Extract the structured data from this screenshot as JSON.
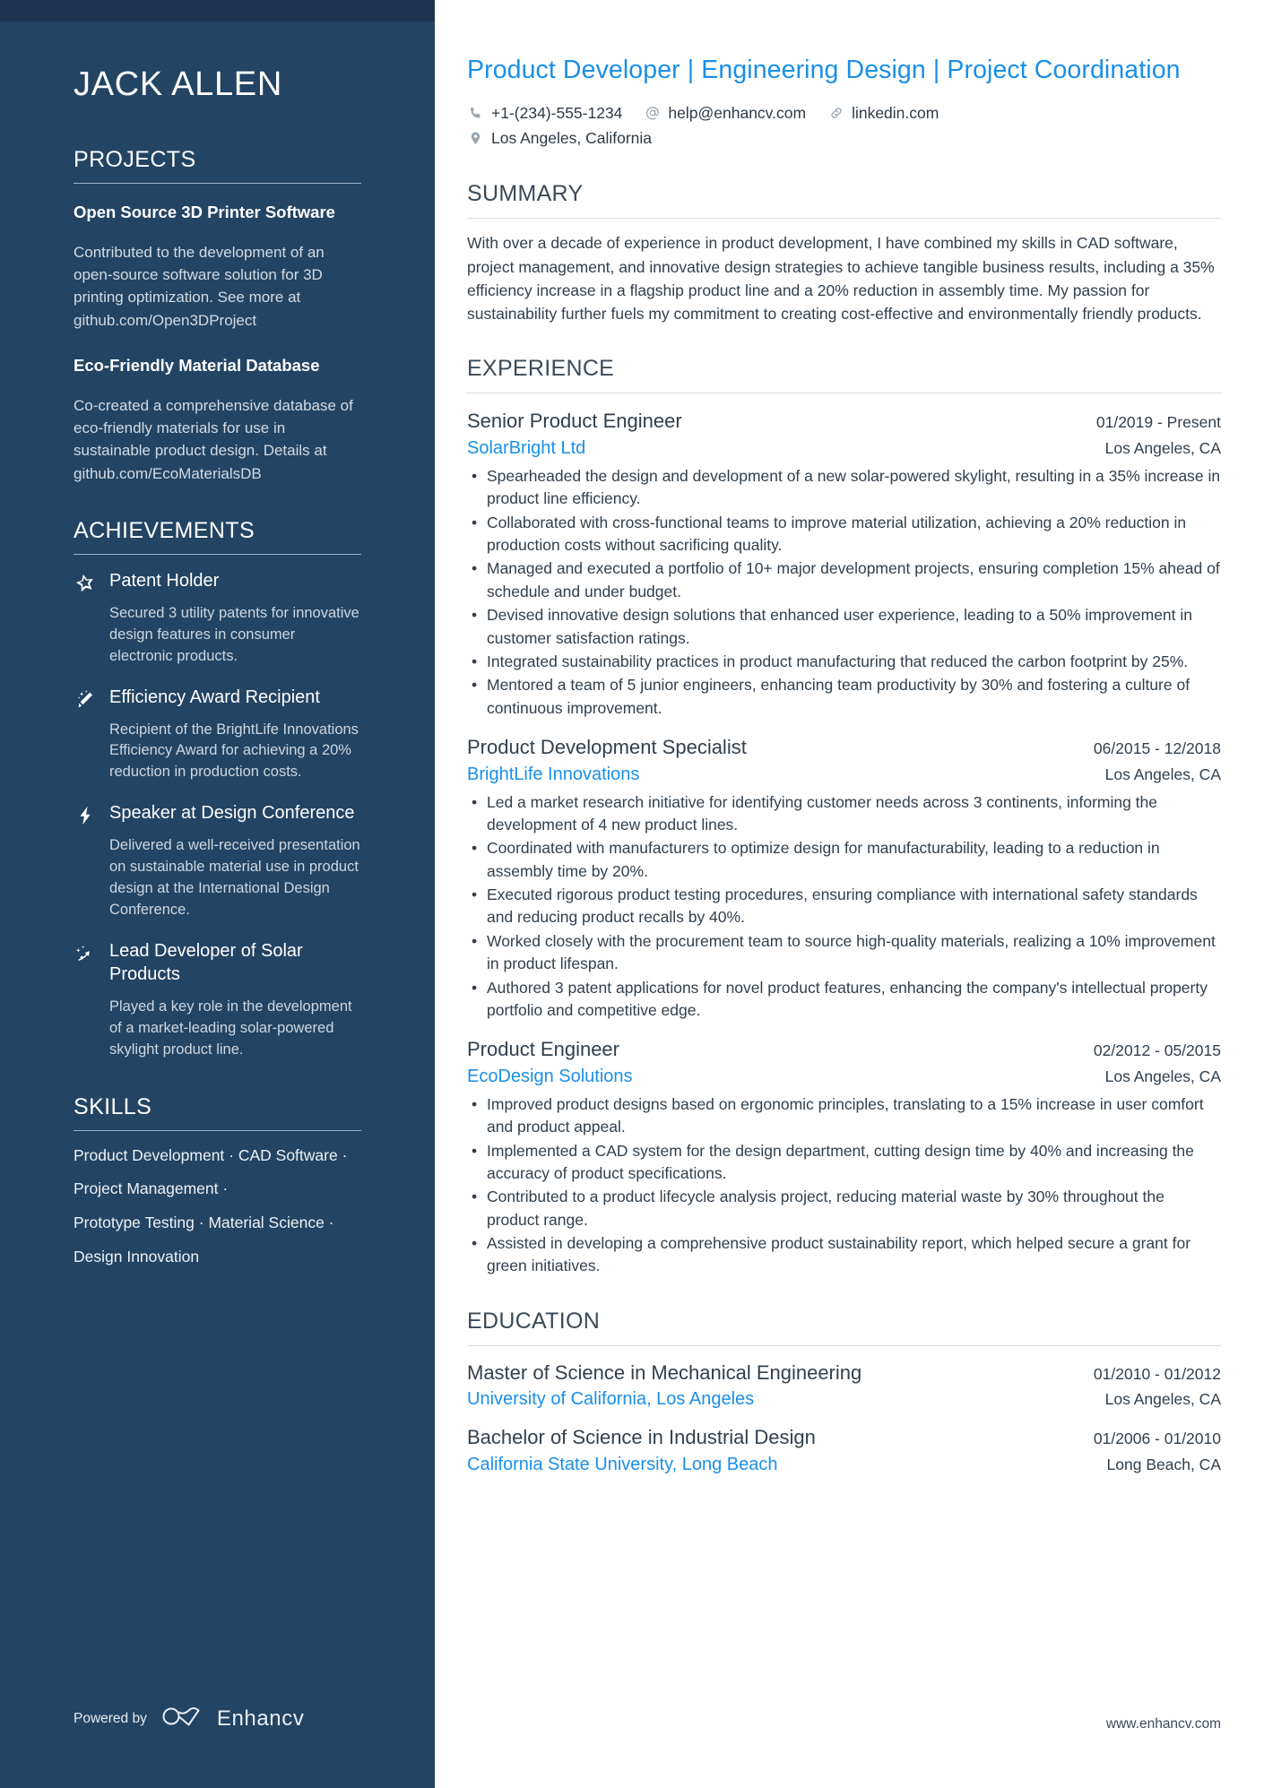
{
  "sidebar": {
    "name": "JACK ALLEN",
    "projects": {
      "title": "PROJECTS",
      "items": [
        {
          "name": "Open Source 3D Printer Software",
          "description": "Contributed to the development of an open-source software solution for 3D printing optimization. See more at github.com/Open3DProject"
        },
        {
          "name": "Eco-Friendly Material Database",
          "description": "Co-created a comprehensive database of eco-friendly materials for use in sustainable product design. Details at github.com/EcoMaterialsDB"
        }
      ]
    },
    "achievements": {
      "title": "ACHIEVEMENTS",
      "items": [
        {
          "icon": "star-icon",
          "name": "Patent Holder",
          "description": "Secured 3 utility patents for innovative design features in consumer electronic products."
        },
        {
          "icon": "magic-wand-icon",
          "name": "Efficiency Award Recipient",
          "description": "Recipient of the BrightLife Innovations Efficiency Award for achieving a 20% reduction in production costs."
        },
        {
          "icon": "lightning-bolt-icon",
          "name": "Speaker at Design Conference",
          "description": "Delivered a well-received presentation on sustainable material use in product design at the International Design Conference."
        },
        {
          "icon": "shooting-star-icon",
          "name": "Lead Developer of Solar Products",
          "description": "Played a key role in the development of a market-leading solar-powered skylight product line."
        }
      ]
    },
    "skills": {
      "title": "SKILLS",
      "lines": [
        "Product Development · CAD Software ·",
        "Project Management ·",
        "Prototype Testing · Material Science ·",
        "Design Innovation"
      ]
    },
    "footer": {
      "powered_by": "Powered by",
      "brand": "Enhancv",
      "logo": "enhancv-infinity-logo"
    }
  },
  "main": {
    "headline": "Product Developer | Engineering Design | Project Coordination",
    "contacts": [
      {
        "icon": "phone-icon",
        "value": "+1-(234)-555-1234"
      },
      {
        "icon": "at-sign-icon",
        "value": "help@enhancv.com"
      },
      {
        "icon": "link-icon",
        "value": "linkedin.com"
      },
      {
        "icon": "location-pin-icon",
        "value": "Los Angeles, California"
      }
    ],
    "summary": {
      "title": "SUMMARY",
      "text": "With over a decade of experience in product development, I have combined my skills in CAD software, project management, and innovative design strategies to achieve tangible business results, including a 35% efficiency increase in a flagship product line and a 20% reduction in assembly time. My passion for sustainability further fuels my commitment to creating cost-effective and environmentally friendly products."
    },
    "experience": {
      "title": "EXPERIENCE",
      "jobs": [
        {
          "title": "Senior Product Engineer",
          "date": "01/2019 - Present",
          "company": "SolarBright Ltd",
          "location": "Los Angeles, CA",
          "bullets": [
            "Spearheaded the design and development of a new solar-powered skylight, resulting in a 35% increase in product line efficiency.",
            "Collaborated with cross-functional teams to improve material utilization, achieving a 20% reduction in production costs without sacrificing quality.",
            "Managed and executed a portfolio of 10+ major development projects, ensuring completion 15% ahead of schedule and under budget.",
            "Devised innovative design solutions that enhanced user experience, leading to a 50% improvement in customer satisfaction ratings.",
            "Integrated sustainability practices in product manufacturing that reduced the carbon footprint by 25%.",
            "Mentored a team of 5 junior engineers, enhancing team productivity by 30% and fostering a culture of continuous improvement."
          ]
        },
        {
          "title": "Product Development Specialist",
          "date": "06/2015 - 12/2018",
          "company": "BrightLife Innovations",
          "location": "Los Angeles, CA",
          "bullets": [
            "Led a market research initiative for identifying customer needs across 3 continents, informing the development of 4 new product lines.",
            "Coordinated with manufacturers to optimize design for manufacturability, leading to a reduction in assembly time by 20%.",
            "Executed rigorous product testing procedures, ensuring compliance with international safety standards and reducing product recalls by 40%.",
            "Worked closely with the procurement team to source high-quality materials, realizing a 10% improvement in product lifespan.",
            "Authored 3 patent applications for novel product features, enhancing the company's intellectual property portfolio and competitive edge."
          ]
        },
        {
          "title": "Product Engineer",
          "date": "02/2012 - 05/2015",
          "company": "EcoDesign Solutions",
          "location": "Los Angeles, CA",
          "bullets": [
            "Improved product designs based on ergonomic principles, translating to a 15% increase in user comfort and product appeal.",
            "Implemented a CAD system for the design department, cutting design time by 40% and increasing the accuracy of product specifications.",
            "Contributed to a product lifecycle analysis project, reducing material waste by 30% throughout the product range.",
            "Assisted in developing a comprehensive product sustainability report, which helped secure a grant for green initiatives."
          ]
        }
      ]
    },
    "education": {
      "title": "EDUCATION",
      "items": [
        {
          "degree": "Master of Science in Mechanical Engineering",
          "date": "01/2010 - 01/2012",
          "school": "University of California, Los Angeles",
          "location": "Los Angeles, CA"
        },
        {
          "degree": "Bachelor of Science in Industrial Design",
          "date": "01/2006 - 01/2010",
          "school": "California State University, Long Beach",
          "location": "Long Beach, CA"
        }
      ]
    },
    "footer": {
      "website": "www.enhancv.com"
    }
  },
  "colors": {
    "sidebar_bg": "#234463",
    "sidebar_top": "#1d3550",
    "accent_blue": "#1a8fe8",
    "heading_slate": "#3b4a58",
    "body_text": "#32404d"
  }
}
